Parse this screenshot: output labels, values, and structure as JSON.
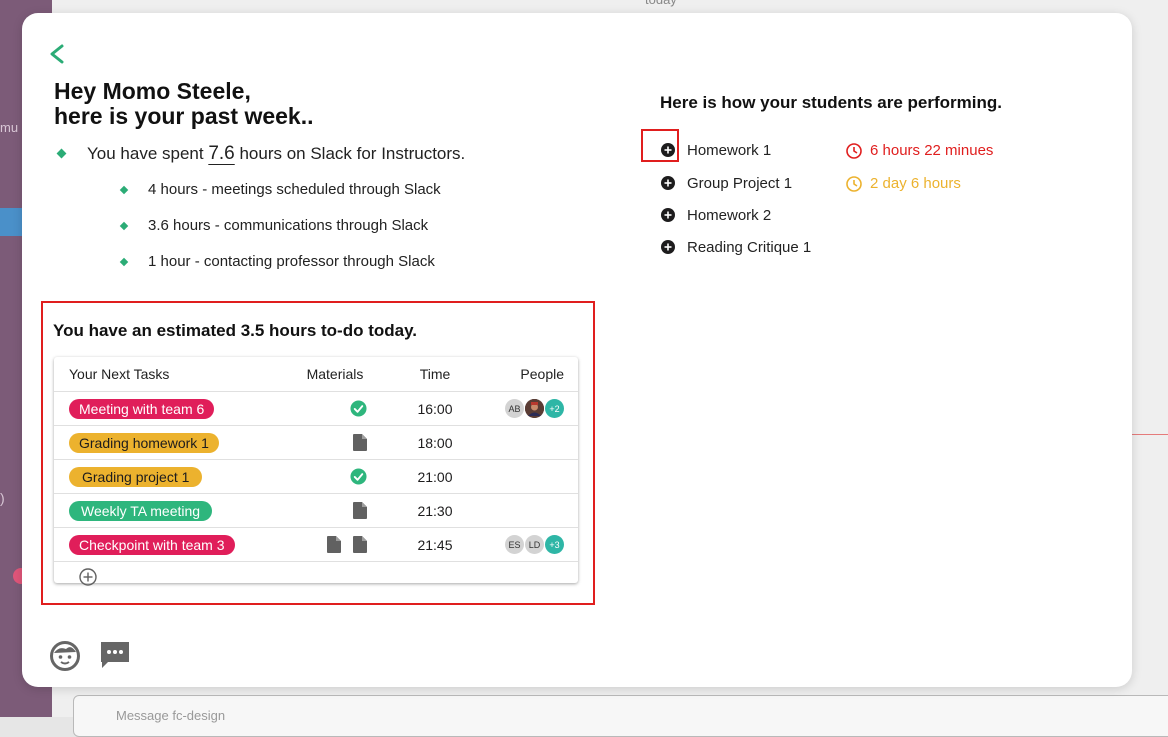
{
  "background": {
    "sidebar_fragment": "mu",
    "top_fragment": "today",
    "paren": ")",
    "message_placeholder": "Message fc-design"
  },
  "header": {
    "greeting_line1": "Hey Momo Steele,",
    "greeting_line2": "here is your past week.."
  },
  "summary": {
    "prefix": "You have spent ",
    "hours": "7.6",
    "suffix": " hours on Slack for Instructors.",
    "breakdown": [
      "4 hours - meetings scheduled through Slack",
      "3.6 hours - communications through Slack",
      "1 hour - contacting professor through Slack"
    ]
  },
  "todo": {
    "title": "You have an estimated 3.5 hours to-do today.",
    "columns": [
      "Your Next Tasks",
      "Materials",
      "Time",
      "People"
    ],
    "rows": [
      {
        "task": "Meeting with team 6",
        "color": "#e01e5a",
        "materials": [
          "check-icon"
        ],
        "time": "16:00",
        "people": [
          "AB",
          "photo",
          "+2"
        ]
      },
      {
        "task": "Grading homework 1",
        "color": "#ecb22e",
        "materials": [
          "document-icon"
        ],
        "time": "18:00",
        "people": []
      },
      {
        "task": "Grading project 1",
        "color": "#ecb22e",
        "materials": [
          "check-icon"
        ],
        "time": "21:00",
        "people": []
      },
      {
        "task": "Weekly TA meeting",
        "color": "#2eb67d",
        "materials": [
          "document-icon"
        ],
        "time": "21:30",
        "people": []
      },
      {
        "task": "Checkpoint with team 3",
        "color": "#e01e5a",
        "materials": [
          "document-icon",
          "document-icon"
        ],
        "time": "21:45",
        "people": [
          "ES",
          "LD",
          "+3"
        ]
      }
    ]
  },
  "performance": {
    "title": "Here is how your students are performing.",
    "items": [
      {
        "name": "Homework 1",
        "due": "6 hours 22 minues",
        "due_color": "#e01e1e"
      },
      {
        "name": "Group Project 1",
        "due": "2 day 6 hours",
        "due_color": "#ecb22e"
      },
      {
        "name": "Homework 2",
        "due": "",
        "due_color": ""
      },
      {
        "name": "Reading Critique 1",
        "due": "",
        "due_color": ""
      }
    ]
  },
  "icons": {
    "back": "chevron-left-icon",
    "bottom": [
      "face-icon",
      "chat-icon"
    ]
  }
}
